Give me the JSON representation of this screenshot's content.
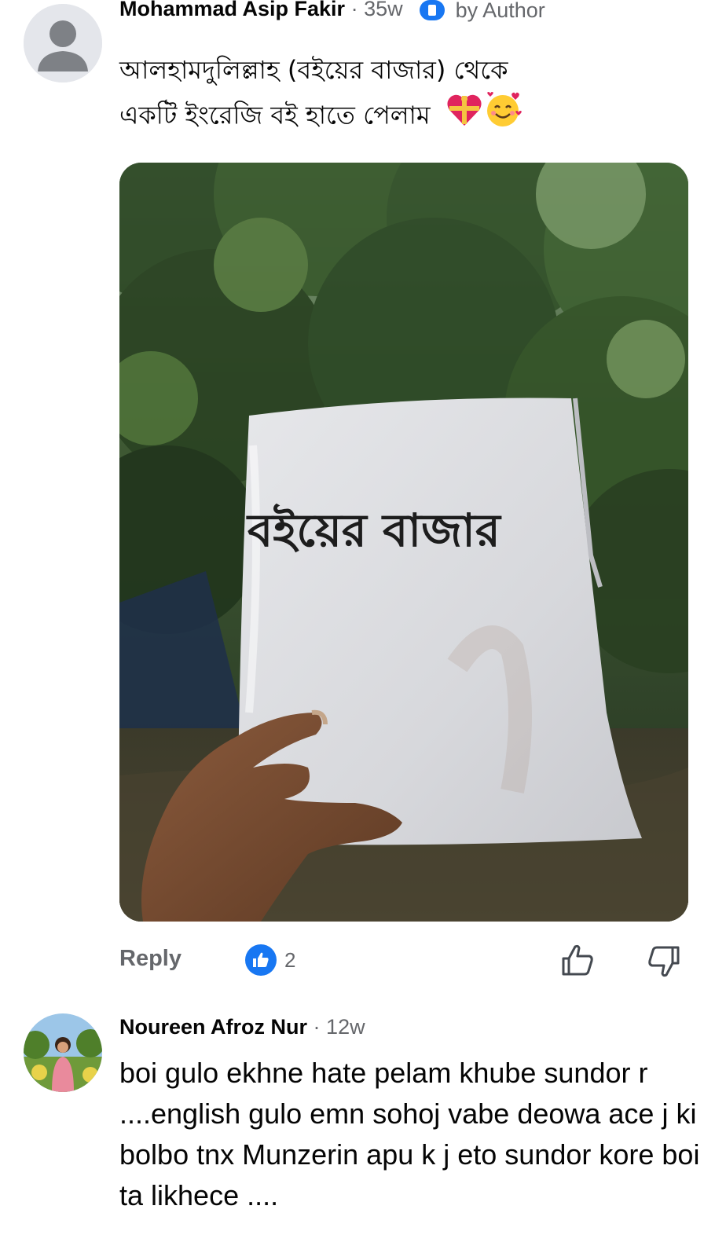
{
  "comment1": {
    "author": "Mohammad Asip Fakir",
    "separator": "·",
    "time": "35w",
    "badge": "by Author",
    "text_line1": "আলহামদুলিল্লাহ (বইয়ের বাজার) থেকে",
    "text_line2": "একটি ইংরেজি বই হাতে পেলাম",
    "emojis": [
      "heart-gift-emoji",
      "smiling-face-with-hearts-emoji"
    ],
    "photo": {
      "stamp_text": "বইয়ের বাজার"
    },
    "actions": {
      "reply_label": "Reply",
      "reaction_count": "2"
    }
  },
  "comment2": {
    "author": "Noureen Afroz Nur",
    "separator": "·",
    "time": "12w",
    "text": "boi gulo ekhne hate pelam khube sundor r ....english gulo emn sohoj vabe deowa ace j ki bolbo tnx Munzerin apu k j eto sundor kore boi ta likhece ...."
  },
  "colors": {
    "facebook_blue": "#1877f2",
    "secondary_text": "#65676b",
    "primary_text": "#050505"
  }
}
